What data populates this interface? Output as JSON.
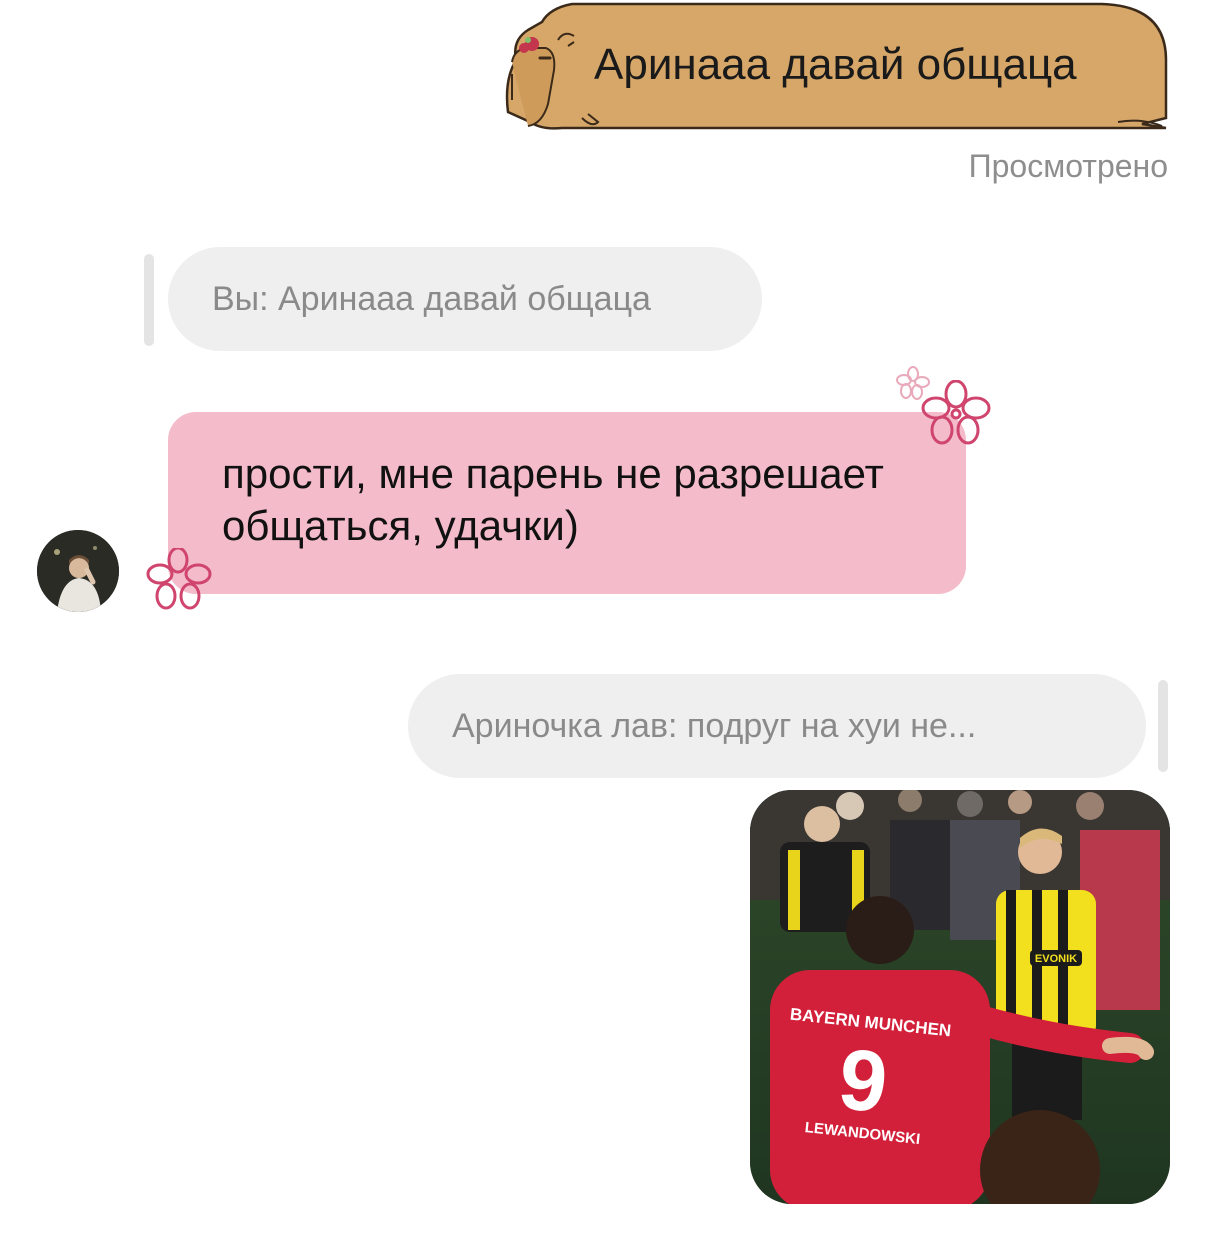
{
  "chat": {
    "outgoing_message": "Аринааа давай общаца",
    "outgoing_status": "Просмотрено",
    "reply_preview_1": "Вы: Аринааа давай общаца",
    "incoming_message": "прости, мне парень не разрешает общаться, удачки)",
    "reply_preview_2": "Ариночка лав: подруг на хуи не...",
    "photo_jersey_name": "BAYERN MUNCHEN",
    "photo_jersey_number": "9",
    "photo_jersey_player": "LEWANDOWSKI",
    "photo_sponsor": "EVONIK"
  },
  "colors": {
    "capybara_bubble": "#d6a768",
    "capybara_outline": "#3b2a1a",
    "incoming_bubble": "#f4bccb",
    "flower": "#d0456e",
    "reply_pill": "#efefef",
    "seen_text": "#8e8e8e"
  },
  "icons": [
    "capybara-sticker-icon",
    "flower-icon",
    "avatar-photo"
  ]
}
